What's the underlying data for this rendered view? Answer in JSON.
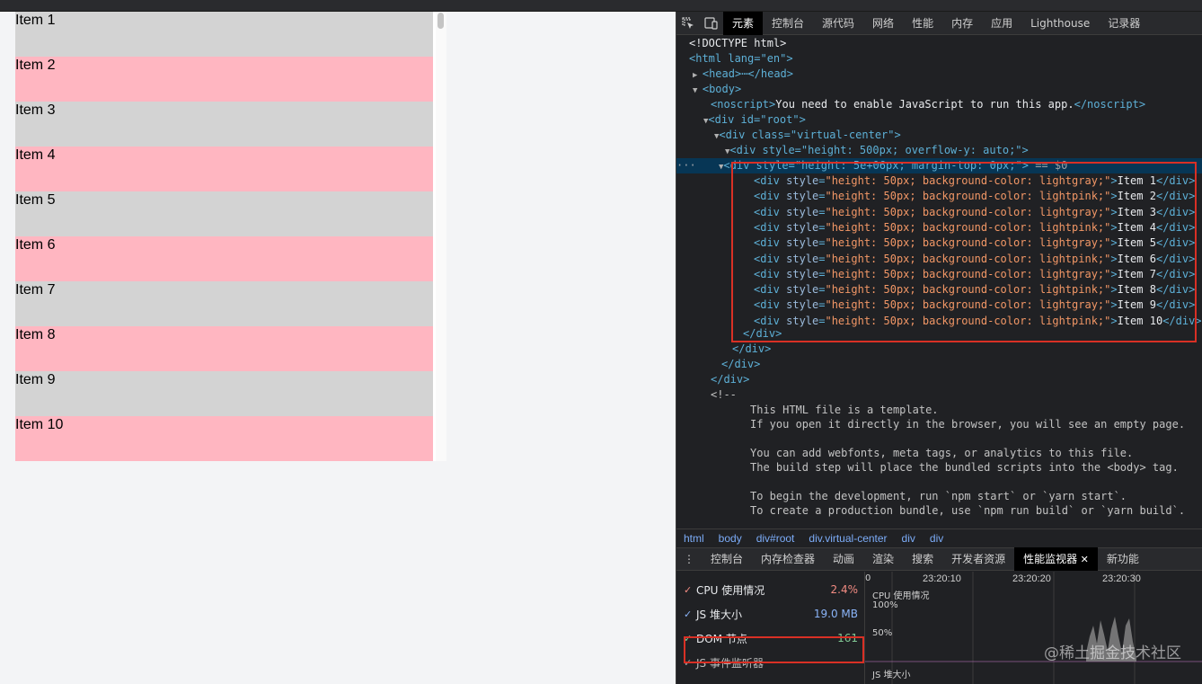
{
  "page": {
    "items": [
      {
        "label": "Item 1",
        "color": "#d3d3d3"
      },
      {
        "label": "Item 2",
        "color": "#ffb6c1"
      },
      {
        "label": "Item 3",
        "color": "#d3d3d3"
      },
      {
        "label": "Item 4",
        "color": "#ffb6c1"
      },
      {
        "label": "Item 5",
        "color": "#d3d3d3"
      },
      {
        "label": "Item 6",
        "color": "#ffb6c1"
      },
      {
        "label": "Item 7",
        "color": "#d3d3d3"
      },
      {
        "label": "Item 8",
        "color": "#ffb6c1"
      },
      {
        "label": "Item 9",
        "color": "#d3d3d3"
      },
      {
        "label": "Item 10",
        "color": "#ffb6c1"
      }
    ]
  },
  "devtools": {
    "tabs": [
      "元素",
      "控制台",
      "源代码",
      "网络",
      "性能",
      "内存",
      "应用",
      "Lighthouse",
      "记录器"
    ],
    "active_tab": "元素",
    "dom": {
      "doctype": "<!DOCTYPE html>",
      "html_open": "<html lang=\"en\">",
      "head": "<head>⋯</head>",
      "body_open": "<body>",
      "noscript_text": "You need to enable JavaScript to run this app.",
      "root_open": "<div id=\"root\">",
      "vc_open": "<div class=\"virtual-center\">",
      "scroll_open": "<div style=\"height: 500px; overflow-y: auto;\">",
      "selected_open": "<div style=\"height: 5e+06px; margin-top: 0px;\">",
      "selected_suffix": "== $0",
      "children": [
        {
          "style": "height: 50px; background-color: lightgray;",
          "text": "Item 1"
        },
        {
          "style": "height: 50px; background-color: lightpink;",
          "text": "Item 2"
        },
        {
          "style": "height: 50px; background-color: lightgray;",
          "text": "Item 3"
        },
        {
          "style": "height: 50px; background-color: lightpink;",
          "text": "Item 4"
        },
        {
          "style": "height: 50px; background-color: lightgray;",
          "text": "Item 5"
        },
        {
          "style": "height: 50px; background-color: lightpink;",
          "text": "Item 6"
        },
        {
          "style": "height: 50px; background-color: lightgray;",
          "text": "Item 7"
        },
        {
          "style": "height: 50px; background-color: lightpink;",
          "text": "Item 8"
        },
        {
          "style": "height: 50px; background-color: lightgray;",
          "text": "Item 9"
        },
        {
          "style": "height: 50px; background-color: lightpink;",
          "text": "Item 10"
        }
      ],
      "comment_lines": [
        "This HTML file is a template.",
        "If you open it directly in the browser, you will see an empty page.",
        "",
        "You can add webfonts, meta tags, or analytics to this file.",
        "The build step will place the bundled scripts into the <body> tag.",
        "",
        "To begin the development, run `npm start` or `yarn start`.",
        "To create a production bundle, use `npm run build` or `yarn build`."
      ]
    },
    "breadcrumbs": [
      "html",
      "body",
      "div#root",
      "div.virtual-center",
      "div",
      "div"
    ],
    "drawer_tabs": [
      "控制台",
      "内存检查器",
      "动画",
      "渲染",
      "搜索",
      "开发者资源",
      "性能监视器",
      "新功能"
    ],
    "drawer_active": "性能监视器",
    "metrics": [
      {
        "label": "CPU 使用情况",
        "value": "2.4%",
        "color": "#f28b82"
      },
      {
        "label": "JS 堆大小",
        "value": "19.0 MB",
        "color": "#8ab4f8"
      },
      {
        "label": "DOM 节点",
        "value": "161",
        "color": "#81c995"
      },
      {
        "label": "JS 事件监听器",
        "value": ""
      }
    ],
    "graph": {
      "times": [
        "23:20:10",
        "23:20:20",
        "23:20:30"
      ],
      "cpu_label": "CPU 使用情况",
      "pct_100": "100%",
      "pct_50": "50%",
      "heap_label": "JS 堆大小",
      "left_tick": "0"
    },
    "watermark": "@稀土掘金技术社区"
  }
}
